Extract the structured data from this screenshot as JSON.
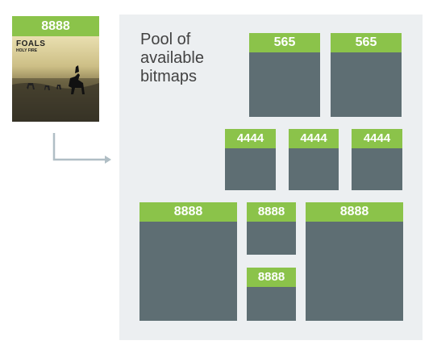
{
  "source": {
    "format": "8888",
    "album": {
      "band": "FOALS",
      "title": "HOLY FIRE"
    }
  },
  "pool": {
    "label_lines": [
      "Pool of",
      "available",
      "bitmaps"
    ],
    "bitmaps": [
      {
        "format": "565"
      },
      {
        "format": "565"
      },
      {
        "format": "4444"
      },
      {
        "format": "4444"
      },
      {
        "format": "4444"
      },
      {
        "format": "8888"
      },
      {
        "format": "8888"
      },
      {
        "format": "8888"
      },
      {
        "format": "8888"
      }
    ]
  },
  "colors": {
    "tag": "#8bc34a",
    "bitmap": "#5e6e73",
    "panel": "#eceff1",
    "arrow": "#b0bec5"
  }
}
